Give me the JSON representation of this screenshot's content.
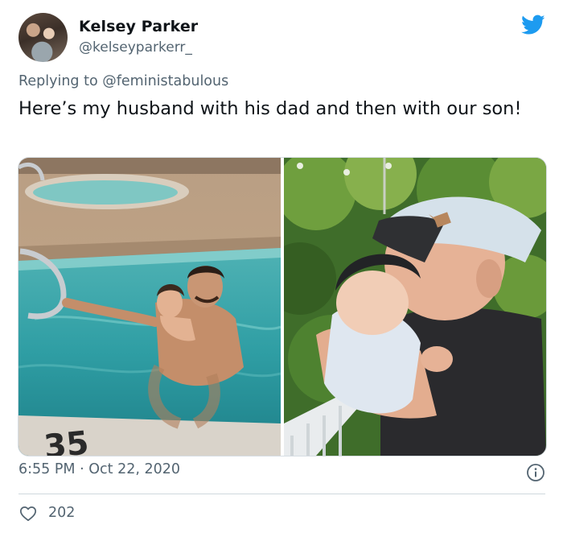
{
  "author": {
    "name": "Kelsey Parker",
    "handle": "@kelseyparkerr_"
  },
  "reply": {
    "prefix": "Replying to",
    "mention": "@feministabulous"
  },
  "tweet": {
    "text": "Here’s my husband with his dad and then with our son!"
  },
  "media": {
    "pool_number_text": "35"
  },
  "meta": {
    "time": "6:55 PM",
    "separator": "·",
    "date": "Oct 22, 2020"
  },
  "engagement": {
    "likes": "202"
  },
  "icons": {
    "logo": "twitter-bird-icon",
    "info": "info-icon",
    "like": "heart-icon"
  },
  "colors": {
    "twitter_blue": "#1d9bf0",
    "secondary_text": "#536471"
  }
}
